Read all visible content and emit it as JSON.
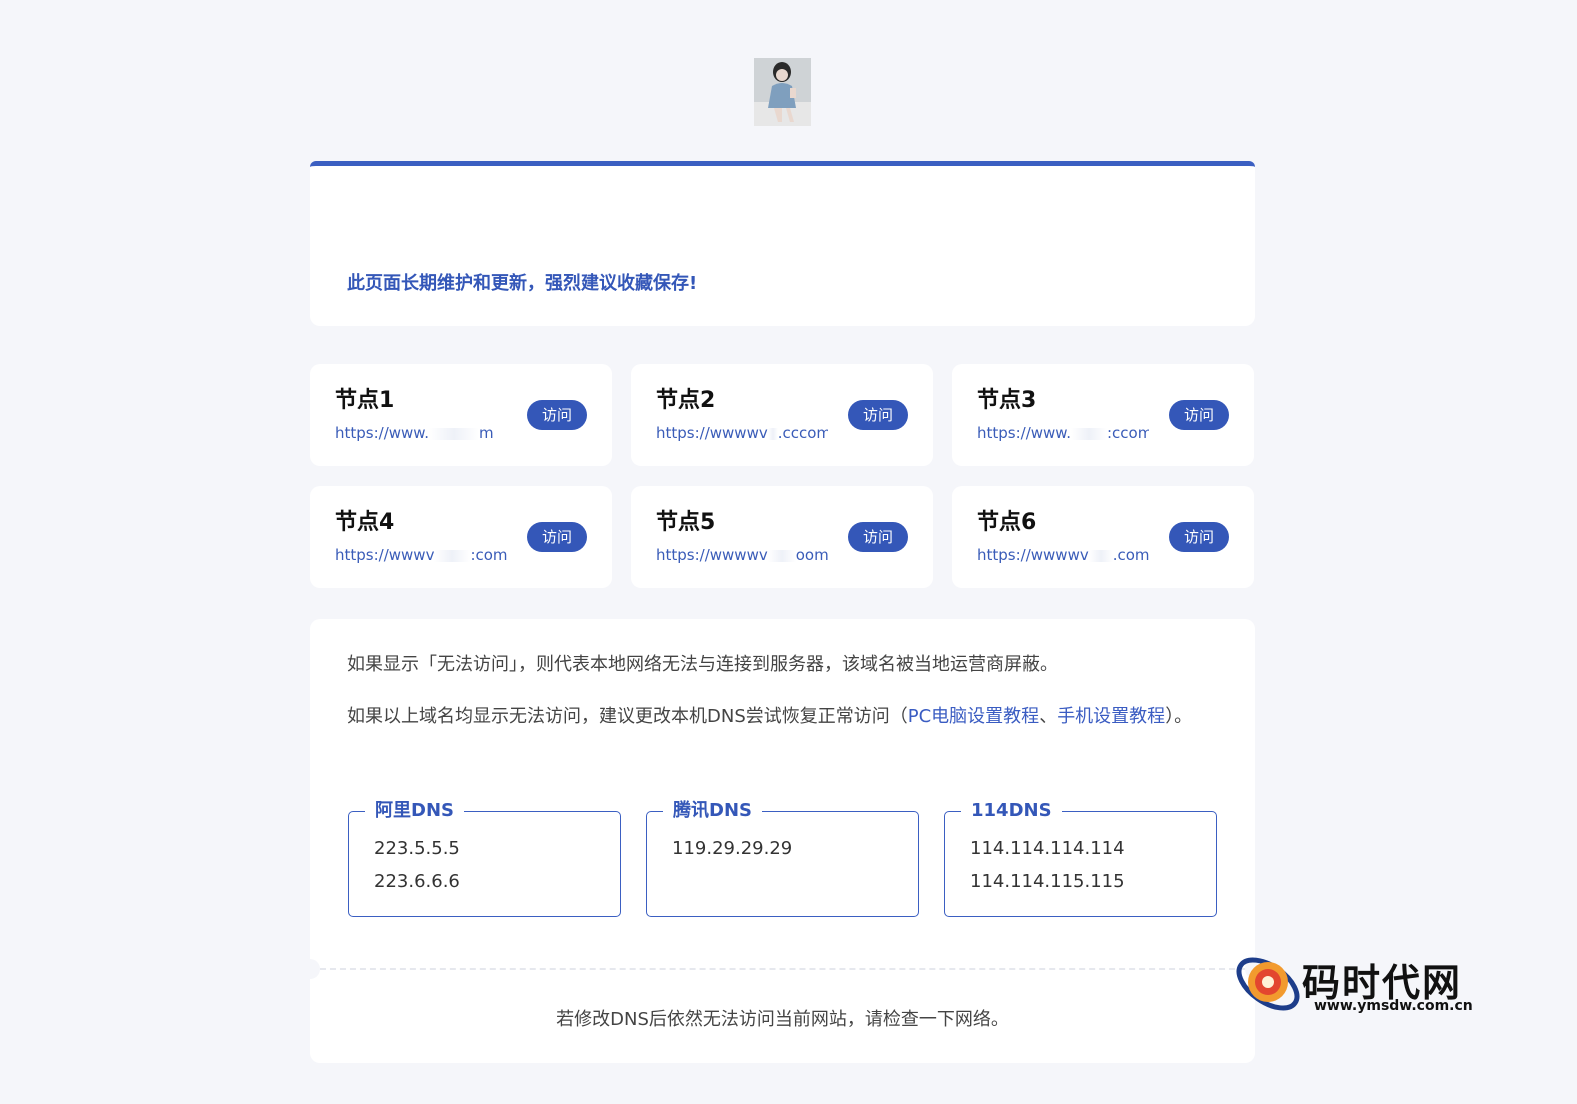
{
  "notice": {
    "text": "此页面长期维护和更新，强烈建议收藏保存!"
  },
  "nodes": [
    {
      "name": "节点1",
      "url_start": "https://www.",
      "url_end": "m",
      "button": "访问"
    },
    {
      "name": "节点2",
      "url_start": "https://wwwwv",
      "url_end": ".cccom",
      "button": "访问"
    },
    {
      "name": "节点3",
      "url_start": "https://www.",
      "url_end": ":ccom",
      "button": "访问"
    },
    {
      "name": "节点4",
      "url_start": "https://wwwv",
      "url_end": ":com",
      "button": "访问"
    },
    {
      "name": "节点5",
      "url_start": "https://wwwwv",
      "url_end": "oom",
      "button": "访问"
    },
    {
      "name": "节点6",
      "url_start": "https://wwwwv",
      "url_end": ".com",
      "button": "访问"
    }
  ],
  "help": {
    "line1": "如果显示「无法访问」，则代表本地网络无法与连接到服务器，该域名被当地运营商屏蔽。",
    "line2_prefix": "如果以上域名均显示无法访问，建议更改本机DNS尝试恢复正常访问（",
    "pc_link": "PC电脑设置教程",
    "separator": "、",
    "mobile_link": "手机设置教程",
    "line2_suffix": "）。"
  },
  "dns": [
    {
      "title": "阿里DNS",
      "ips": [
        "223.5.5.5",
        "223.6.6.6"
      ]
    },
    {
      "title": "腾讯DNS",
      "ips": [
        "119.29.29.29"
      ]
    },
    {
      "title": "114DNS",
      "ips": [
        "114.114.114.114",
        "114.114.115.115"
      ]
    }
  ],
  "footer": {
    "text": "若修改DNS后依然无法访问当前网站，请检查一下网络。"
  },
  "watermark": {
    "title": "码时代网",
    "url": "www.ymsdw.com.cn"
  },
  "colors": {
    "accent": "#3457b8",
    "background": "#f5f6fa"
  }
}
